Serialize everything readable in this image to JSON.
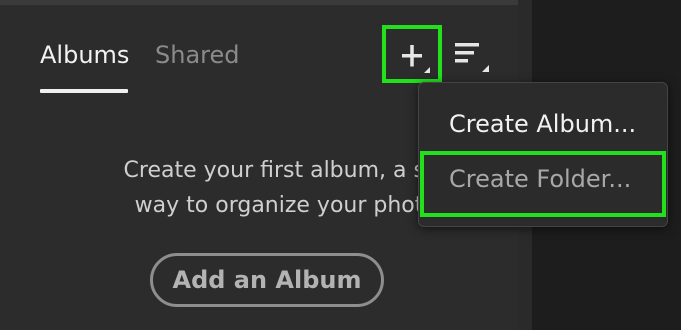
{
  "tabs": [
    {
      "label": "Albums",
      "active": true
    },
    {
      "label": "Shared",
      "active": false
    }
  ],
  "toolbar": {
    "add_icon": "plus-icon",
    "sort_icon": "sort-icon"
  },
  "empty_state": {
    "line1": "Create your first album, a simp",
    "line2": "way to organize your photos.",
    "button_label": "Add an Album"
  },
  "menu": {
    "items": [
      {
        "label": "Create Album..."
      },
      {
        "label": "Create Folder..."
      }
    ]
  },
  "colors": {
    "highlight": "#22e11c",
    "panel": "#2c2c2c",
    "background": "#1d1d1d"
  }
}
